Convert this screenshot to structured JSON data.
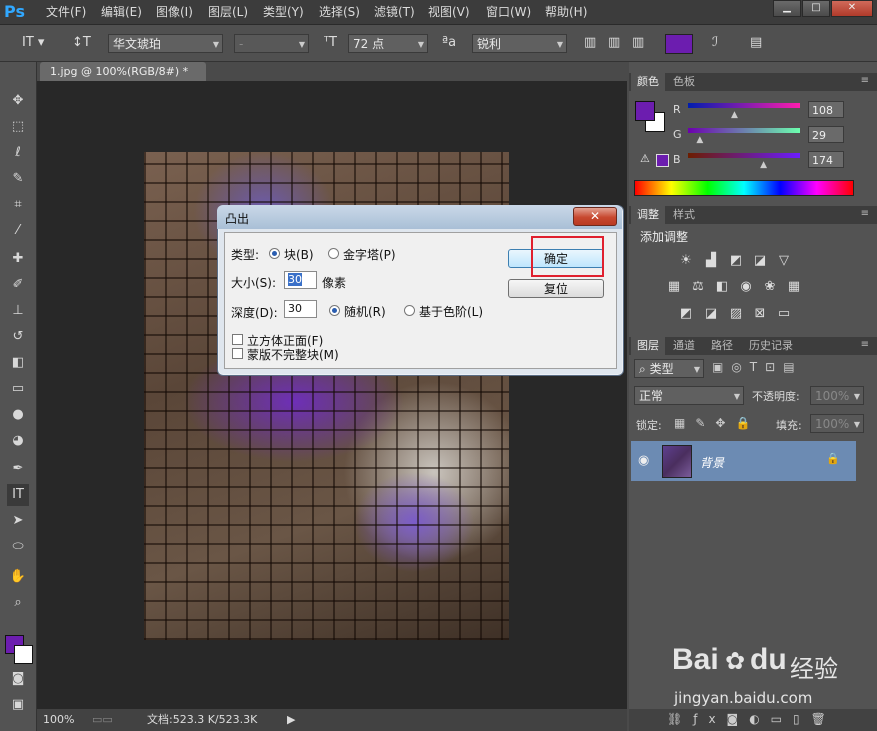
{
  "app": {
    "logo": "Ps"
  },
  "menu": [
    "文件(F)",
    "编辑(E)",
    "图像(I)",
    "图层(L)",
    "类型(Y)",
    "选择(S)",
    "滤镜(T)",
    "视图(V)",
    "窗口(W)",
    "帮助(H)"
  ],
  "window_controls": {
    "minimize": "▁",
    "maximize": "□",
    "close": "✕"
  },
  "options": {
    "font_family": "华文琥珀",
    "font_style": "-",
    "font_size": "72 点",
    "aa_label": "ªa",
    "antialias": "锐利",
    "text_color": "#6c1daf"
  },
  "document": {
    "tab_label": "1.jpg @ 100%(RGB/8#) *",
    "close": "×"
  },
  "status": {
    "zoom": "100%",
    "doc_info": "文档:523.3 K/523.3K"
  },
  "color_panel": {
    "tabs": [
      "颜色",
      "色板"
    ],
    "foreground": "#6c1daf",
    "r_label": "R",
    "g_label": "G",
    "b_label": "B",
    "r_value": "108",
    "g_value": "29",
    "b_value": "174",
    "r_fraction": 0.42,
    "g_fraction": 0.11,
    "b_fraction": 0.68
  },
  "adjust_panel": {
    "tabs": [
      "调整",
      "样式"
    ],
    "title": "添加调整"
  },
  "layers_panel": {
    "tabs": [
      "图层",
      "通道",
      "路径",
      "历史记录"
    ],
    "filter_kind": "类型",
    "blend_mode": "正常",
    "opacity_label": "不透明度:",
    "opacity_value": "100%",
    "lock_label": "锁定:",
    "fill_label": "填充:",
    "fill_value": "100%",
    "layers": [
      {
        "name": "背景",
        "visible": true,
        "locked": true
      }
    ]
  },
  "dialog": {
    "title": "凸出",
    "type_label": "类型:",
    "type_block": "块(B)",
    "type_pyramid": "金字塔(P)",
    "size_label": "大小(S):",
    "size_value": "30",
    "size_unit": "像素",
    "depth_label": "深度(D):",
    "depth_value": "30",
    "depth_random": "随机(R)",
    "depth_level": "基于色阶(L)",
    "solid_front": "立方体正面(F)",
    "mask_incomplete": "蒙版不完整块(M)",
    "ok": "确定",
    "reset": "复位"
  },
  "watermark": {
    "brand": "Bai",
    "brand2": "du",
    "jingyan": "经验",
    "url": "jingyan.baidu.com"
  }
}
